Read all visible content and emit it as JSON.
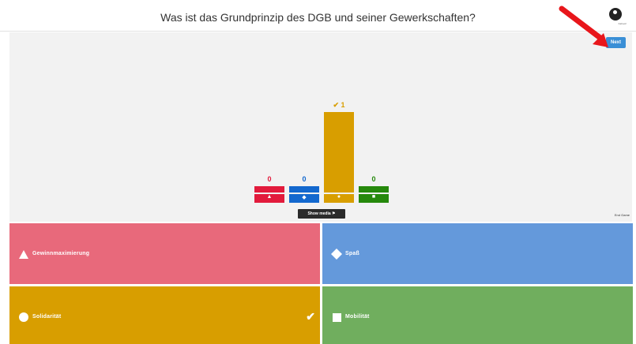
{
  "header": {
    "question": "Was ist das Grundprinzip des DGB und seiner Gewerkschaften?",
    "logo_icon": "kahoot-logo-icon",
    "logo_caption": "Kahoot!"
  },
  "toolbar": {
    "next_label": "Next",
    "show_media_label": "Show media",
    "end_game_label": "End Game"
  },
  "annotation": {
    "arrow_color": "#e8161b",
    "arrow_icon": "red-arrow-icon"
  },
  "results": [
    {
      "count": "0",
      "votes": 0,
      "color": "#e21b3c",
      "symbol": "▲",
      "shape": "triangle",
      "correct": false
    },
    {
      "count": "0",
      "votes": 0,
      "color": "#1368ce",
      "symbol": "◆",
      "shape": "diamond",
      "correct": false
    },
    {
      "count": "1",
      "votes": 1,
      "color": "#d89e00",
      "symbol": "●",
      "shape": "circle",
      "correct": true,
      "correct_mark": "✔"
    },
    {
      "count": "0",
      "votes": 0,
      "color": "#26890c",
      "symbol": "■",
      "shape": "square",
      "correct": false
    }
  ],
  "answers": [
    {
      "label": "Gewinnmaximierung",
      "color": "#e8697b",
      "shape": "triangle",
      "correct": false
    },
    {
      "label": "Spaß",
      "color": "#6499db",
      "shape": "diamond",
      "correct": false
    },
    {
      "label": "Solidarität",
      "color": "#d89e00",
      "shape": "circle",
      "correct": true,
      "check_icon": "✔"
    },
    {
      "label": "Mobilität",
      "color": "#70ae5e",
      "shape": "square",
      "correct": false
    }
  ]
}
